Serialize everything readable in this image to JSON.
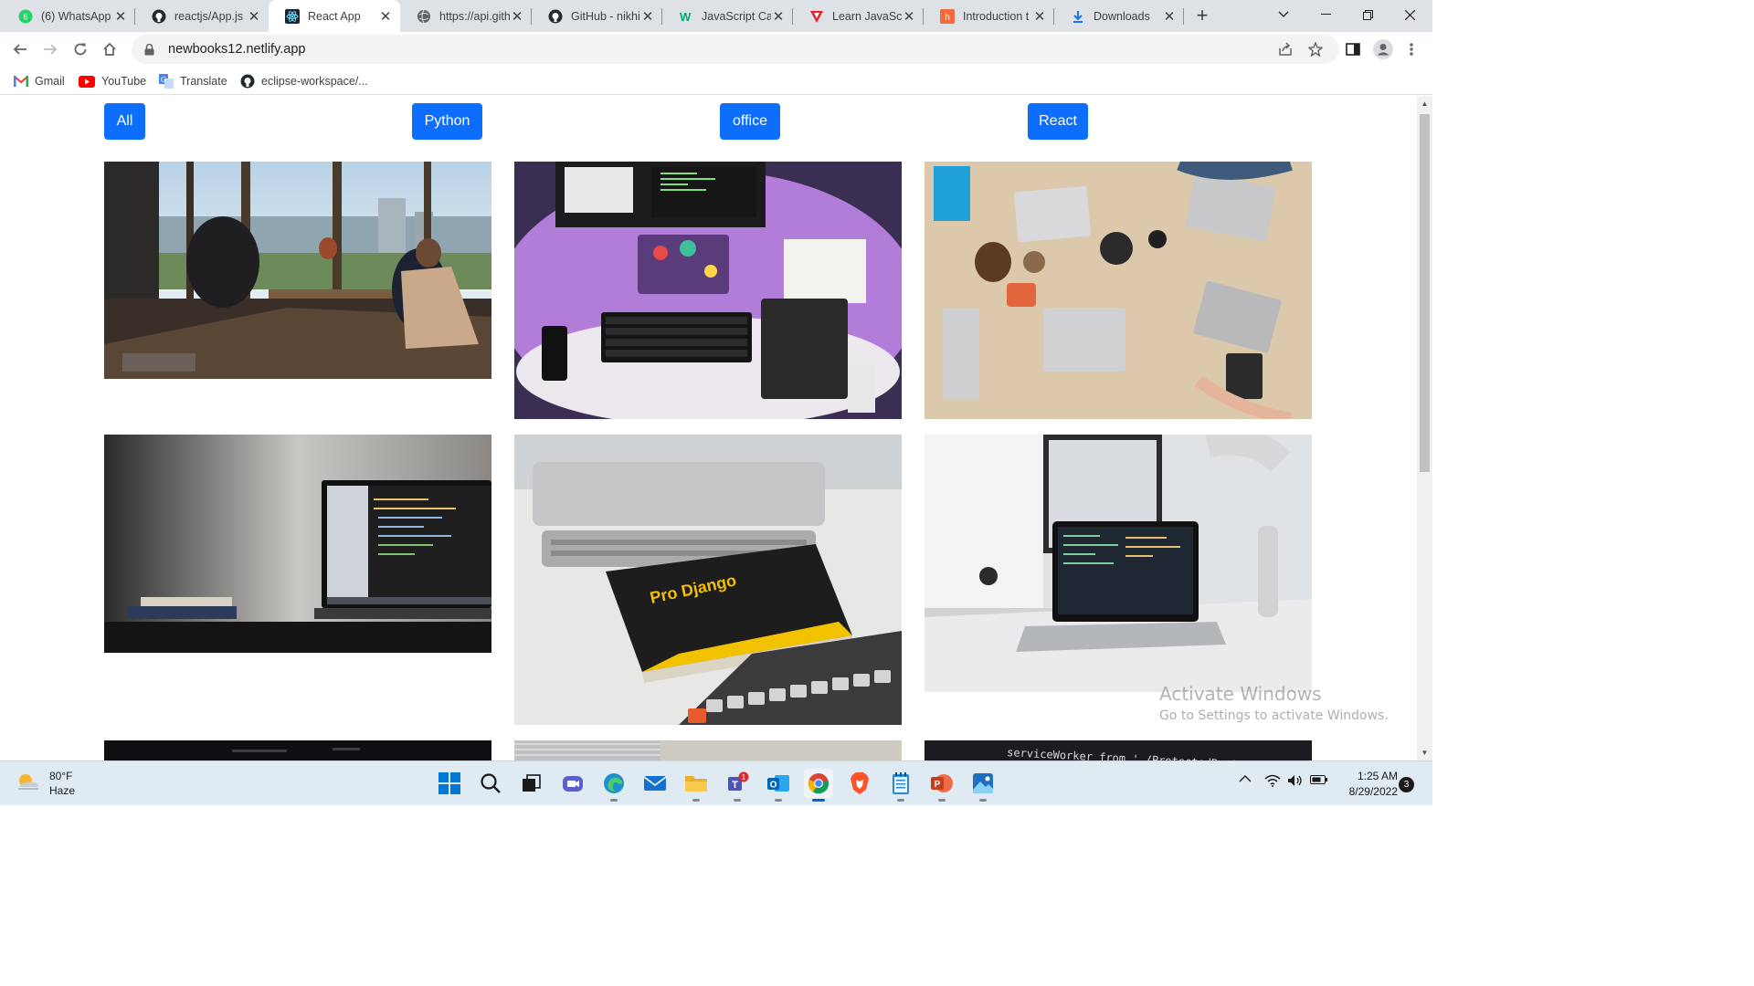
{
  "browser": {
    "tabs": [
      {
        "title": "(6) WhatsApp",
        "icon": "whatsapp-icon",
        "active": false
      },
      {
        "title": "reactjs/App.js",
        "icon": "github-icon",
        "active": false
      },
      {
        "title": "React App",
        "icon": "react-icon",
        "active": true
      },
      {
        "title": "https://api.gith",
        "icon": "globe-icon",
        "active": false
      },
      {
        "title": "GitHub - nikhi",
        "icon": "github-icon",
        "active": false
      },
      {
        "title": "JavaScript Call",
        "icon": "w3-icon",
        "active": false
      },
      {
        "title": "Learn JavaScrip",
        "icon": "vivaldi-icon",
        "active": false
      },
      {
        "title": "Introduction t",
        "icon": "hashnode-icon",
        "active": false
      },
      {
        "title": "Downloads",
        "icon": "download-icon",
        "active": false
      }
    ],
    "whatsapp_badge": "6",
    "url": "newbooks12.netlify.app",
    "bookmarks": [
      {
        "label": "Gmail",
        "icon": "gmail-icon"
      },
      {
        "label": "YouTube",
        "icon": "youtube-icon"
      },
      {
        "label": "Translate",
        "icon": "translate-icon"
      },
      {
        "label": "eclipse-workspace/...",
        "icon": "github-icon"
      }
    ]
  },
  "page": {
    "filters": [
      "All",
      "Python",
      "office",
      "React"
    ],
    "accent_color": "#0d6efd",
    "gallery": [
      {
        "alt": "Office with city view",
        "icon": "photo-office-window"
      },
      {
        "alt": "Purple desk setup",
        "icon": "photo-purple-desk"
      },
      {
        "alt": "Team laptops table",
        "icon": "photo-team-table"
      },
      {
        "alt": "Laptop with code on dark desk",
        "icon": "photo-laptop-dark"
      },
      {
        "alt": "Pro Django book",
        "icon": "photo-django-book"
      },
      {
        "alt": "Laptop on white desk",
        "icon": "photo-laptop-white"
      },
      {
        "alt": "Dark screen",
        "icon": "photo-dark-screen"
      },
      {
        "alt": "Blinds",
        "icon": "photo-blinds"
      },
      {
        "alt": "serviceWorker code",
        "icon": "photo-code"
      }
    ],
    "django_book_title": "Pro Django",
    "code_text": "serviceWorker from './ProtectedRoute"
  },
  "windows": {
    "watermark_title": "Activate Windows",
    "watermark_sub": "Go to Settings to activate Windows."
  },
  "taskbar": {
    "weather_temp": "80°F",
    "weather_desc": "Haze",
    "time": "1:25 AM",
    "date": "8/29/2022",
    "notification_count": "3",
    "teams_badge": "1"
  }
}
